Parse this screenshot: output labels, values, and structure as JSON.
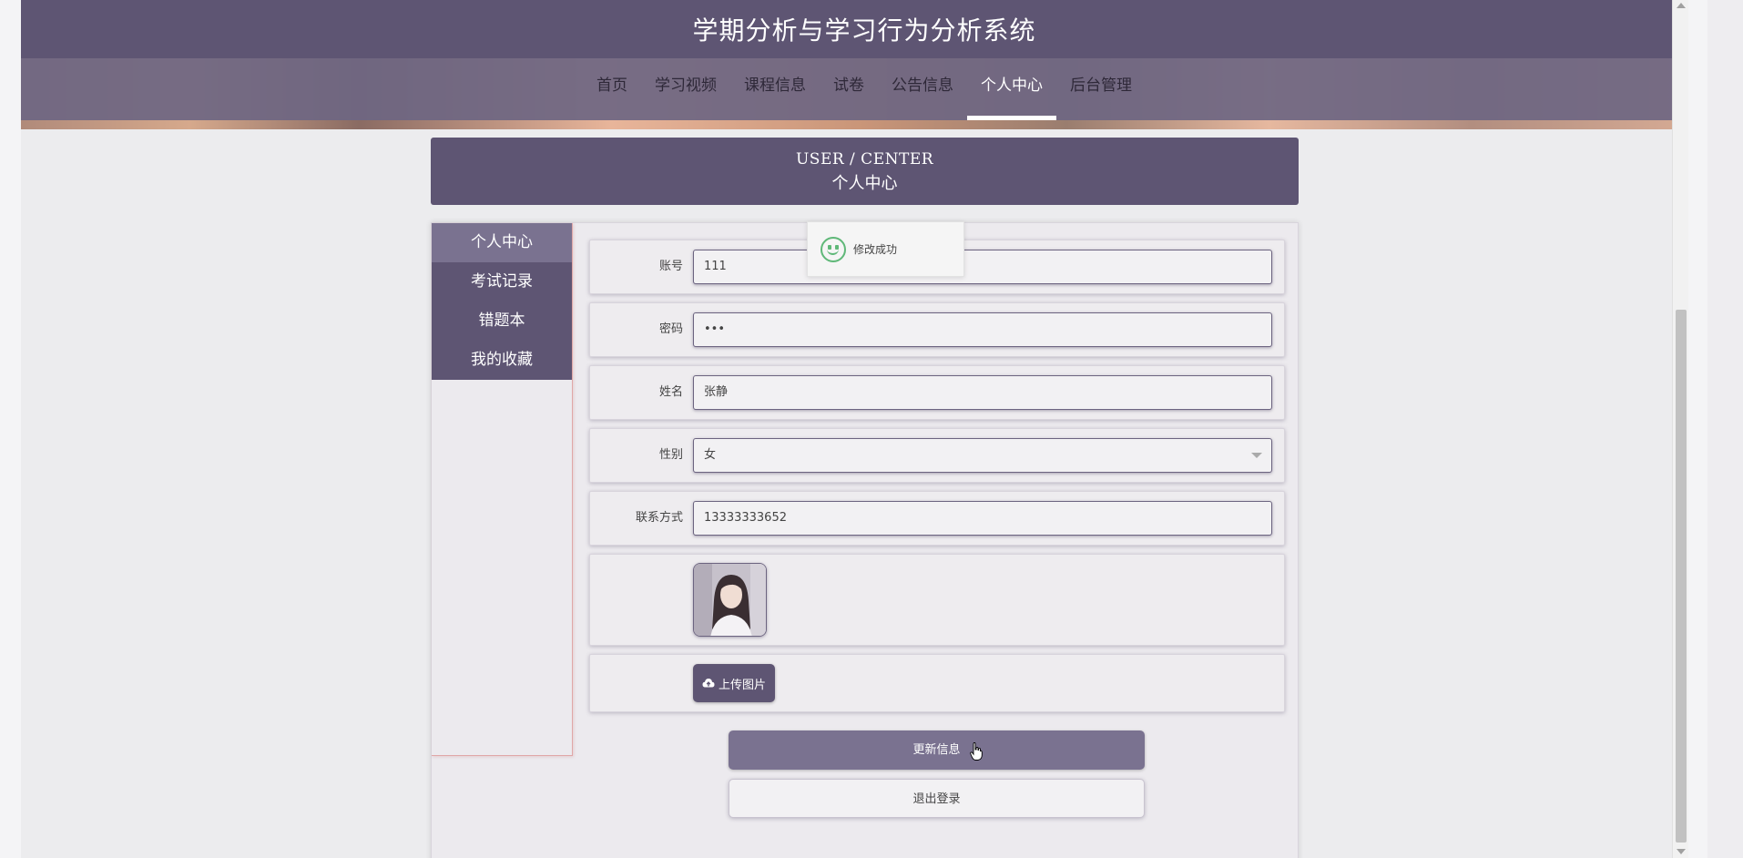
{
  "header": {
    "title": "学期分析与学习行为分析系统"
  },
  "nav": {
    "items": [
      {
        "label": "首页"
      },
      {
        "label": "学习视频"
      },
      {
        "label": "课程信息"
      },
      {
        "label": "试卷"
      },
      {
        "label": "公告信息"
      },
      {
        "label": "个人中心",
        "active": true
      },
      {
        "label": "后台管理"
      }
    ]
  },
  "section": {
    "title_en": "USER / CENTER",
    "title_zh": "个人中心"
  },
  "side_menu": {
    "items": [
      {
        "label": "个人中心",
        "active": true
      },
      {
        "label": "考试记录"
      },
      {
        "label": "错题本"
      },
      {
        "label": "我的收藏"
      }
    ]
  },
  "form": {
    "account": {
      "label": "账号",
      "value": "111"
    },
    "password": {
      "label": "密码",
      "value": "•••"
    },
    "name": {
      "label": "姓名",
      "value": "张静"
    },
    "gender": {
      "label": "性别",
      "value": "女"
    },
    "contact": {
      "label": "联系方式",
      "value": "13333333652"
    },
    "upload_label": "上传图片",
    "update_label": "更新信息",
    "logout_label": "退出登录"
  },
  "toast": {
    "message": "修改成功"
  },
  "colors": {
    "primary": "#5e5573",
    "secondary": "#7a7290",
    "success": "#5fb878"
  }
}
